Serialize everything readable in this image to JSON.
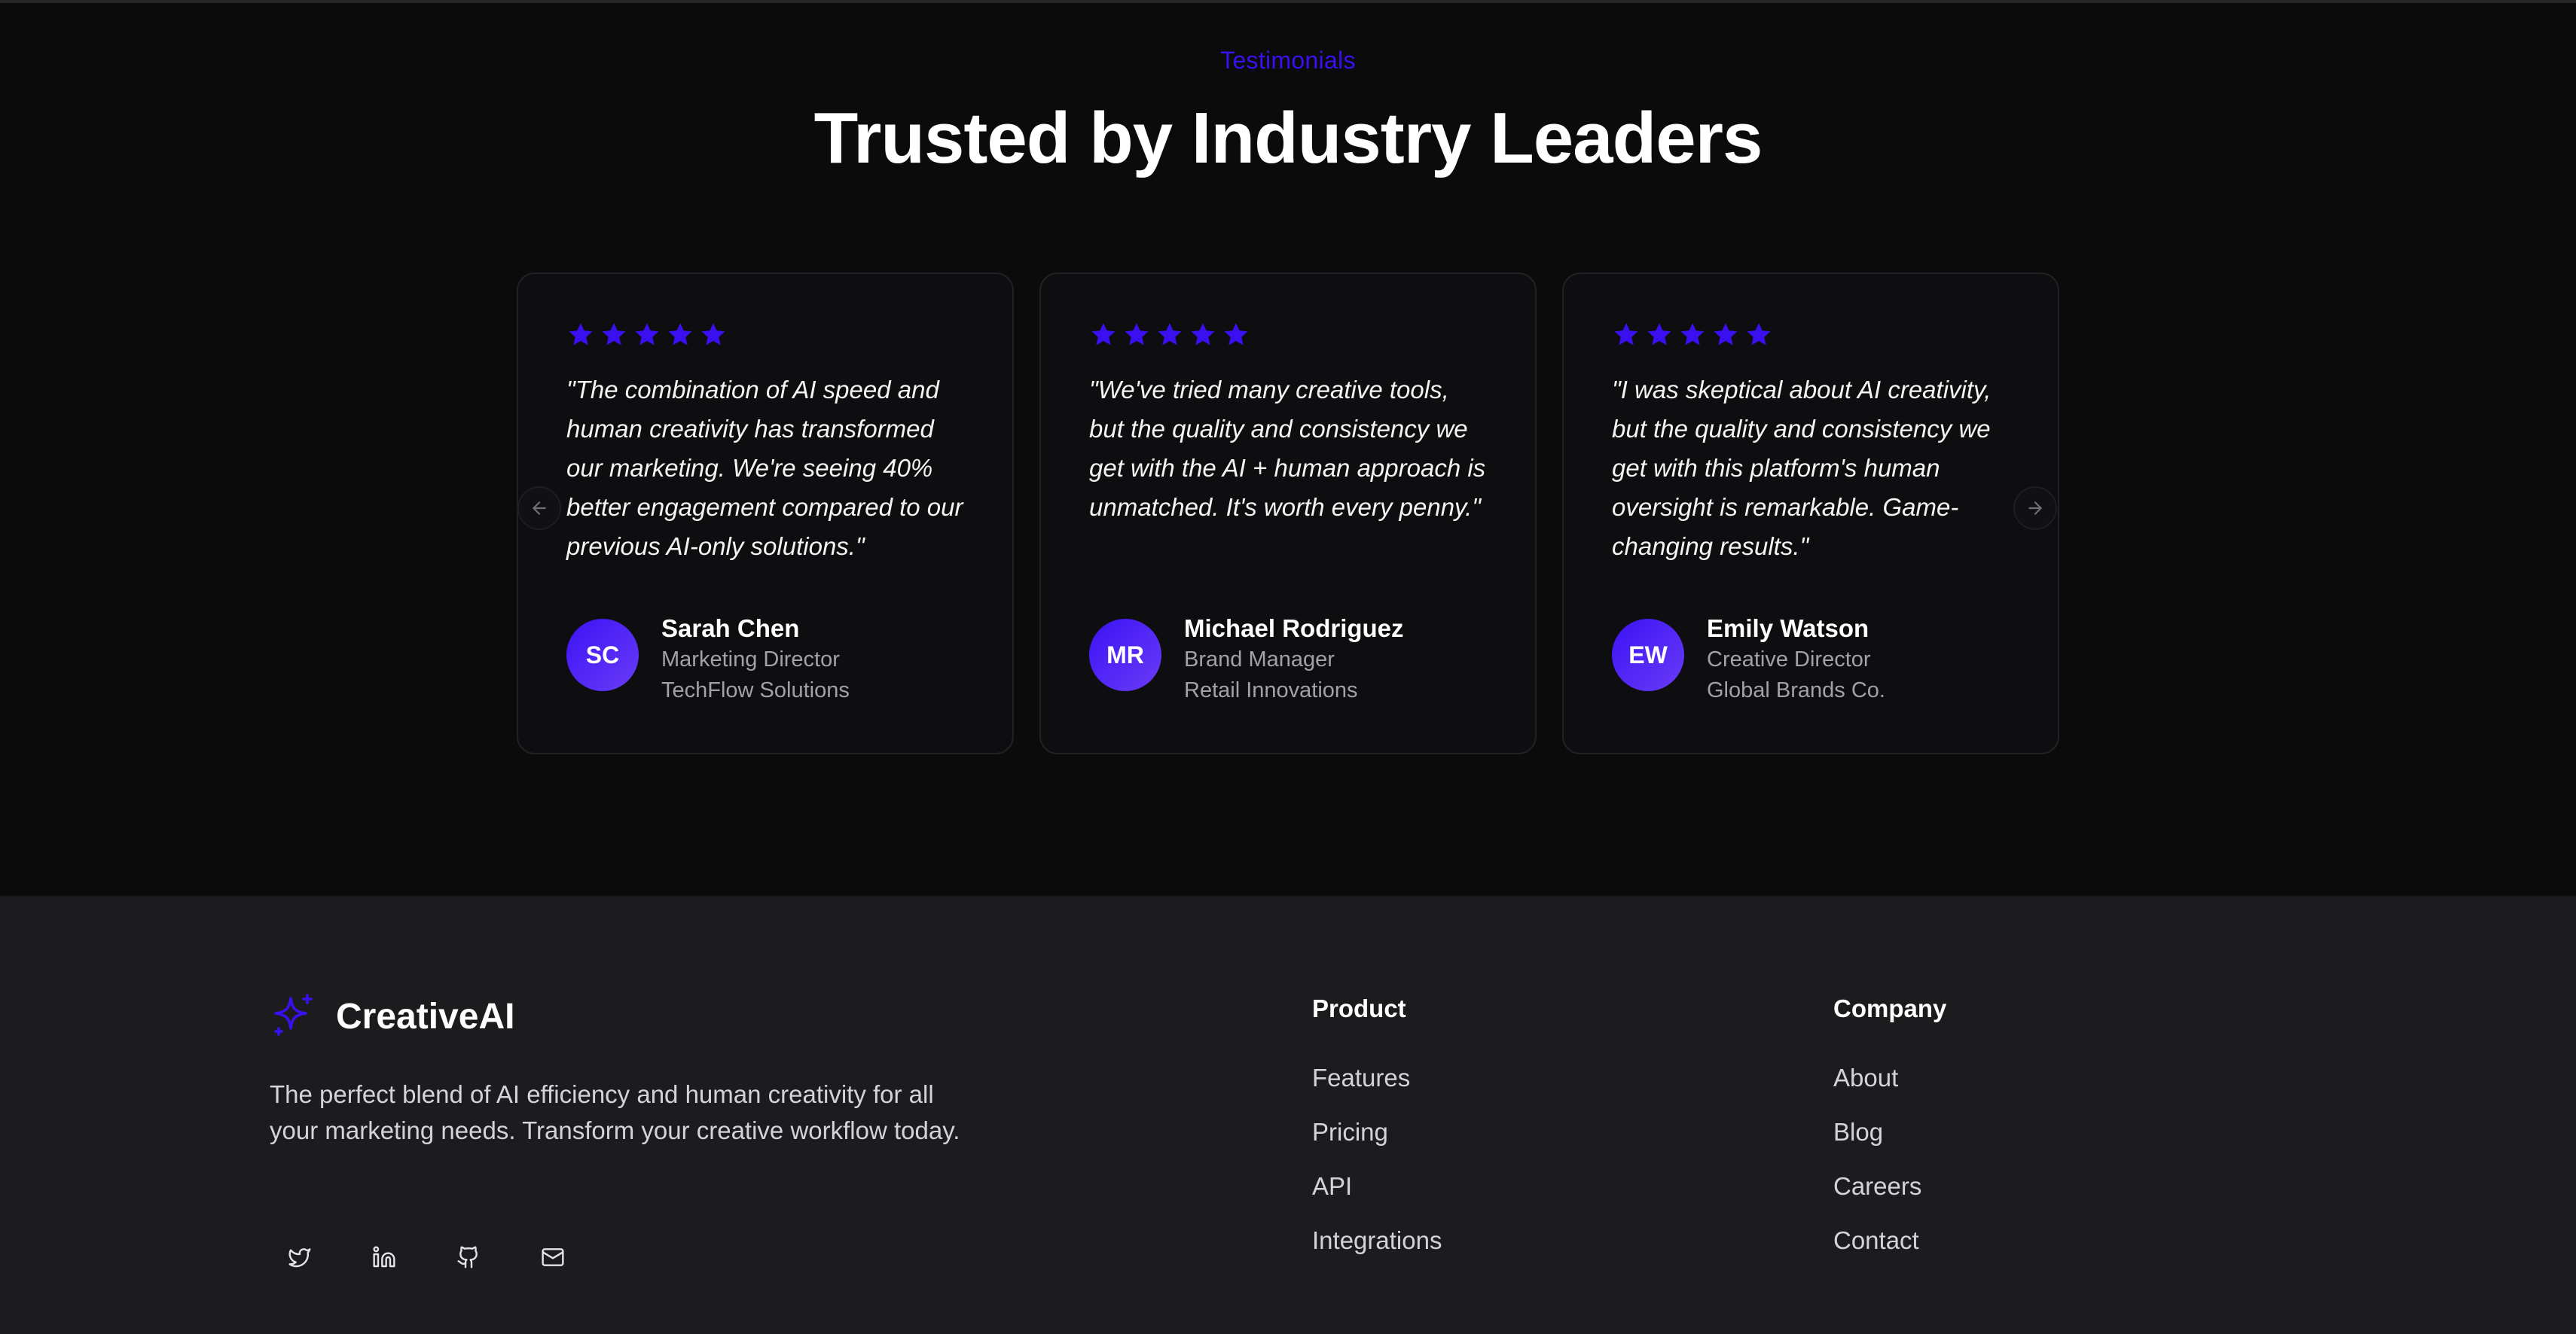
{
  "testimonials": {
    "eyebrow": "Testimonials",
    "headline": "Trusted by Industry Leaders",
    "accent_color": "#3a0ff0",
    "rating": 5,
    "cards": [
      {
        "quote": "\"The combination of AI speed and human creativity has transformed our marketing. We're seeing 40% better engagement compared to our previous AI-only solutions.\"",
        "initials": "SC",
        "name": "Sarah Chen",
        "role": "Marketing Director",
        "company": "TechFlow Solutions"
      },
      {
        "quote": "\"We've tried many creative tools, but the quality and consistency we get with the AI + human approach is unmatched. It's worth every penny.\"",
        "initials": "MR",
        "name": "Michael Rodriguez",
        "role": "Brand Manager",
        "company": "Retail Innovations"
      },
      {
        "quote": "\"I was skeptical about AI creativity, but the quality and consistency we get with this platform's human oversight is remarkable. Game-changing results.\"",
        "initials": "EW",
        "name": "Emily Watson",
        "role": "Creative Director",
        "company": "Global Brands Co."
      }
    ],
    "prev_icon": "arrow-left-icon",
    "next_icon": "arrow-right-icon"
  },
  "footer": {
    "brand": {
      "name": "CreativeAI",
      "icon": "sparkle-icon",
      "description": "The perfect blend of AI efficiency and human creativity for all your marketing needs. Transform your creative workflow today."
    },
    "socials": [
      "twitter-icon",
      "linkedin-icon",
      "github-icon",
      "mail-icon"
    ],
    "columns": [
      {
        "title": "Product",
        "links": [
          "Features",
          "Pricing",
          "API",
          "Integrations"
        ]
      },
      {
        "title": "Company",
        "links": [
          "About",
          "Blog",
          "Careers",
          "Contact"
        ]
      }
    ]
  }
}
